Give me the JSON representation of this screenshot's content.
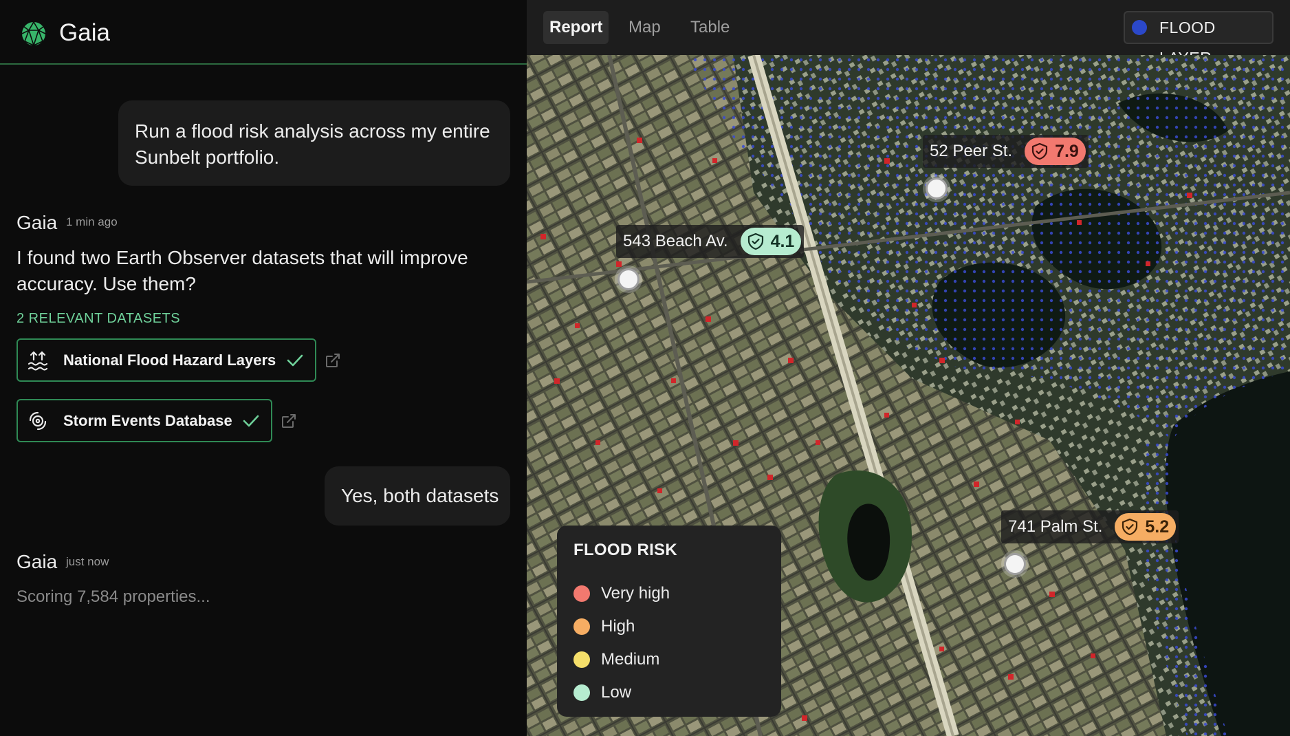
{
  "app": {
    "name": "Gaia"
  },
  "chat": {
    "user_message_1": "Run a flood risk analysis across my entire Sunbelt portfolio.",
    "reply_1": {
      "sender": "Gaia",
      "time": "1 min ago",
      "text": "I found two Earth Observer datasets that will improve accuracy. Use them?",
      "section_label": "2 RELEVANT DATASETS",
      "datasets": [
        {
          "label": "National Flood Hazard Layers",
          "icon": "flood-waves-icon",
          "selected": true
        },
        {
          "label": "Storm Events Database",
          "icon": "storm-icon",
          "selected": true
        }
      ]
    },
    "user_message_2": "Yes, both datasets",
    "reply_2": {
      "sender": "Gaia",
      "time": "just now",
      "status": "Scoring 7,584 properties..."
    }
  },
  "map_view": {
    "tabs": [
      {
        "label": "Report",
        "active": true
      },
      {
        "label": "Map",
        "active": false
      },
      {
        "label": "Table",
        "active": false
      }
    ],
    "layer_toggle": {
      "label": "FLOOD LAYER",
      "color": "#2b48c9"
    },
    "properties": [
      {
        "name": "52 Peer St.",
        "score": "7.9",
        "risk": "Very high"
      },
      {
        "name": "543 Beach Av.",
        "score": "4.1",
        "risk": "Low"
      },
      {
        "name": "741 Palm St.",
        "score": "5.2",
        "risk": "High"
      }
    ],
    "legend": {
      "title": "FLOOD RISK",
      "items": [
        {
          "label": "Very high",
          "color": "#f2796f"
        },
        {
          "label": "High",
          "color": "#f6ad63"
        },
        {
          "label": "Medium",
          "color": "#f5df6a"
        },
        {
          "label": "Low",
          "color": "#b6ecd0"
        }
      ]
    }
  }
}
